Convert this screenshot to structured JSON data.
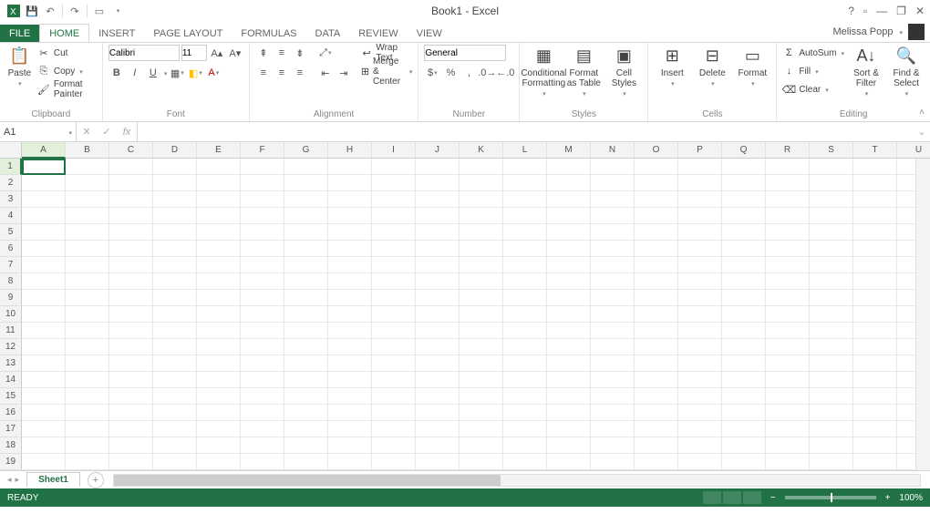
{
  "title": "Book1 - Excel",
  "user": {
    "name": "Melissa Popp"
  },
  "tabs": {
    "file": "FILE",
    "home": "HOME",
    "insert": "INSERT",
    "page_layout": "PAGE LAYOUT",
    "formulas": "FORMULAS",
    "data": "DATA",
    "review": "REVIEW",
    "view": "VIEW"
  },
  "ribbon": {
    "clipboard": {
      "label": "Clipboard",
      "paste": "Paste",
      "cut": "Cut",
      "copy": "Copy",
      "format_painter": "Format Painter"
    },
    "font": {
      "label": "Font",
      "family": "Calibri",
      "size": "11"
    },
    "alignment": {
      "label": "Alignment",
      "wrap": "Wrap Text",
      "merge": "Merge & Center"
    },
    "number": {
      "label": "Number",
      "format": "General"
    },
    "styles": {
      "label": "Styles",
      "cond": "Conditional Formatting",
      "table": "Format as Table",
      "cell": "Cell Styles"
    },
    "cells": {
      "label": "Cells",
      "insert": "Insert",
      "delete": "Delete",
      "format": "Format"
    },
    "editing": {
      "label": "Editing",
      "autosum": "AutoSum",
      "fill": "Fill",
      "clear": "Clear",
      "sort": "Sort & Filter",
      "find": "Find & Select"
    }
  },
  "namebox": "A1",
  "columns": [
    "A",
    "B",
    "C",
    "D",
    "E",
    "F",
    "G",
    "H",
    "I",
    "J",
    "K",
    "L",
    "M",
    "N",
    "O",
    "P",
    "Q",
    "R",
    "S",
    "T",
    "U"
  ],
  "rows": [
    "1",
    "2",
    "3",
    "4",
    "5",
    "6",
    "7",
    "8",
    "9",
    "10",
    "11",
    "12",
    "13",
    "14",
    "15",
    "16",
    "17",
    "18",
    "19"
  ],
  "sheet": {
    "name": "Sheet1"
  },
  "status": {
    "ready": "READY",
    "zoom": "100%"
  }
}
